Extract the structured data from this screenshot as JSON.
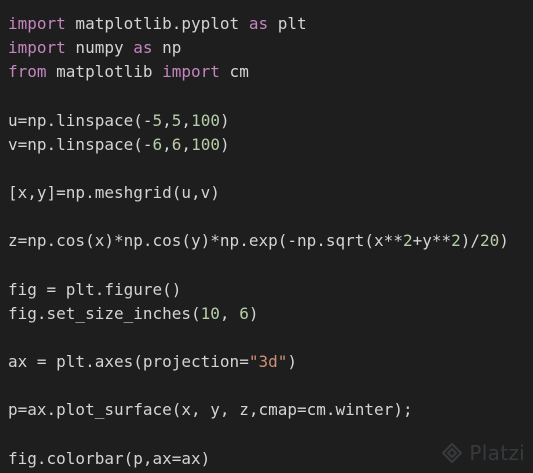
{
  "code": {
    "lines": [
      [
        {
          "t": "import",
          "c": "kw"
        },
        {
          "t": " matplotlib.pyplot ",
          "c": "plain"
        },
        {
          "t": "as",
          "c": "kw"
        },
        {
          "t": " plt",
          "c": "plain"
        }
      ],
      [
        {
          "t": "import",
          "c": "kw"
        },
        {
          "t": " numpy ",
          "c": "plain"
        },
        {
          "t": "as",
          "c": "kw"
        },
        {
          "t": " np",
          "c": "plain"
        }
      ],
      [
        {
          "t": "from",
          "c": "kw"
        },
        {
          "t": " matplotlib ",
          "c": "plain"
        },
        {
          "t": "import",
          "c": "kw"
        },
        {
          "t": " cm",
          "c": "plain"
        }
      ],
      [],
      [
        {
          "t": "u=np.linspace(-",
          "c": "plain"
        },
        {
          "t": "5",
          "c": "num"
        },
        {
          "t": ",",
          "c": "plain"
        },
        {
          "t": "5",
          "c": "num"
        },
        {
          "t": ",",
          "c": "plain"
        },
        {
          "t": "100",
          "c": "num"
        },
        {
          "t": ")",
          "c": "plain"
        }
      ],
      [
        {
          "t": "v=np.linspace(-",
          "c": "plain"
        },
        {
          "t": "6",
          "c": "num"
        },
        {
          "t": ",",
          "c": "plain"
        },
        {
          "t": "6",
          "c": "num"
        },
        {
          "t": ",",
          "c": "plain"
        },
        {
          "t": "100",
          "c": "num"
        },
        {
          "t": ")",
          "c": "plain"
        }
      ],
      [],
      [
        {
          "t": "[x,y]=np.meshgrid(u,v)",
          "c": "plain"
        }
      ],
      [],
      [
        {
          "t": "z=np.cos(x)*np.cos(y)*np.exp(-np.sqrt(x**",
          "c": "plain"
        },
        {
          "t": "2",
          "c": "num"
        },
        {
          "t": "+y**",
          "c": "plain"
        },
        {
          "t": "2",
          "c": "num"
        },
        {
          "t": ")/",
          "c": "plain"
        },
        {
          "t": "20",
          "c": "num"
        },
        {
          "t": ")",
          "c": "plain"
        }
      ],
      [],
      [
        {
          "t": "fig = plt.figure()",
          "c": "plain"
        }
      ],
      [
        {
          "t": "fig.set_size_inches(",
          "c": "plain"
        },
        {
          "t": "10",
          "c": "num"
        },
        {
          "t": ", ",
          "c": "plain"
        },
        {
          "t": "6",
          "c": "num"
        },
        {
          "t": ")",
          "c": "plain"
        }
      ],
      [],
      [
        {
          "t": "ax = plt.axes(projection=",
          "c": "plain"
        },
        {
          "t": "\"3d\"",
          "c": "str"
        },
        {
          "t": ")",
          "c": "plain"
        }
      ],
      [],
      [
        {
          "t": "p=ax.plot_surface(x, y, z,cmap=cm.winter);",
          "c": "plain"
        }
      ],
      [],
      [
        {
          "t": "fig.colorbar(p,ax=ax)",
          "c": "plain"
        }
      ]
    ]
  },
  "watermark": {
    "text": "Platzi",
    "icon": "platzi-logo-icon"
  },
  "colors": {
    "background": "#1e1e1e",
    "keyword": "#c586c0",
    "string": "#ce9178",
    "number": "#b5cea8",
    "text": "#d4d4d4"
  }
}
